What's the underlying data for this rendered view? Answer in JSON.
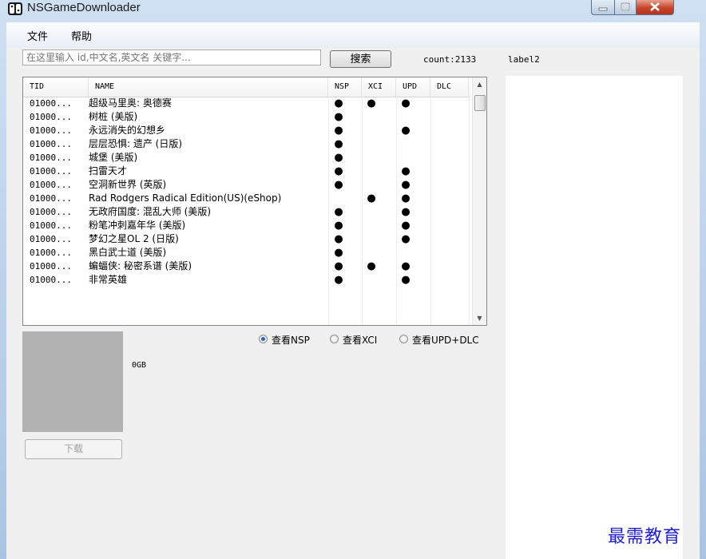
{
  "window": {
    "title": "NSGameDownloader"
  },
  "menu": {
    "items": [
      "文件",
      "帮助"
    ]
  },
  "search": {
    "placeholder": "在这里输入 id,中文名,英文名 关键字...",
    "button_label": "搜索",
    "count_label": "count:2133"
  },
  "right_label": "label2",
  "table": {
    "columns": [
      "TID",
      "NAME",
      "NSP",
      "XCI",
      "UPD",
      "DLC"
    ],
    "rows": [
      {
        "tid": "01000...",
        "name": "超级马里奥: 奥德赛",
        "nsp": true,
        "xci": true,
        "upd": true,
        "dlc": false
      },
      {
        "tid": "01000...",
        "name": "树桩 (美版)",
        "nsp": true,
        "xci": false,
        "upd": false,
        "dlc": false
      },
      {
        "tid": "01000...",
        "name": "永远消失的幻想乡",
        "nsp": true,
        "xci": false,
        "upd": true,
        "dlc": false
      },
      {
        "tid": "01000...",
        "name": "层层恐惧: 遗产 (日版)",
        "nsp": true,
        "xci": false,
        "upd": false,
        "dlc": false
      },
      {
        "tid": "01000...",
        "name": "城堡 (美版)",
        "nsp": true,
        "xci": false,
        "upd": false,
        "dlc": false
      },
      {
        "tid": "01000...",
        "name": "扫雷天才",
        "nsp": true,
        "xci": false,
        "upd": true,
        "dlc": false
      },
      {
        "tid": "01000...",
        "name": "空洞新世界 (英版)",
        "nsp": true,
        "xci": false,
        "upd": true,
        "dlc": false
      },
      {
        "tid": "01000...",
        "name": "Rad Rodgers Radical Edition(US)(eShop)",
        "nsp": false,
        "xci": true,
        "upd": true,
        "dlc": false
      },
      {
        "tid": "01000...",
        "name": "无政府国度: 混乱大师 (美版)",
        "nsp": true,
        "xci": false,
        "upd": true,
        "dlc": false
      },
      {
        "tid": "01000...",
        "name": "粉笔冲刺嘉年华 (美版)",
        "nsp": true,
        "xci": false,
        "upd": true,
        "dlc": false
      },
      {
        "tid": "01000...",
        "name": "梦幻之星OL 2 (日版)",
        "nsp": true,
        "xci": false,
        "upd": true,
        "dlc": false
      },
      {
        "tid": "01000...",
        "name": "黑白武士道 (美版)",
        "nsp": true,
        "xci": false,
        "upd": false,
        "dlc": false
      },
      {
        "tid": "01000...",
        "name": "蝙蝠侠: 秘密系谱 (美版)",
        "nsp": true,
        "xci": true,
        "upd": true,
        "dlc": false
      },
      {
        "tid": "01000...",
        "name": "非常英雄",
        "nsp": true,
        "xci": false,
        "upd": true,
        "dlc": false
      }
    ]
  },
  "view_options": [
    {
      "label": "查看NSP",
      "checked": true
    },
    {
      "label": "查看XCI",
      "checked": false
    },
    {
      "label": "查看UPD+DLC",
      "checked": false
    }
  ],
  "preview": {
    "size_label": "0GB",
    "download_label": "下载"
  },
  "watermark": "最需教育",
  "dot_glyph": "●"
}
